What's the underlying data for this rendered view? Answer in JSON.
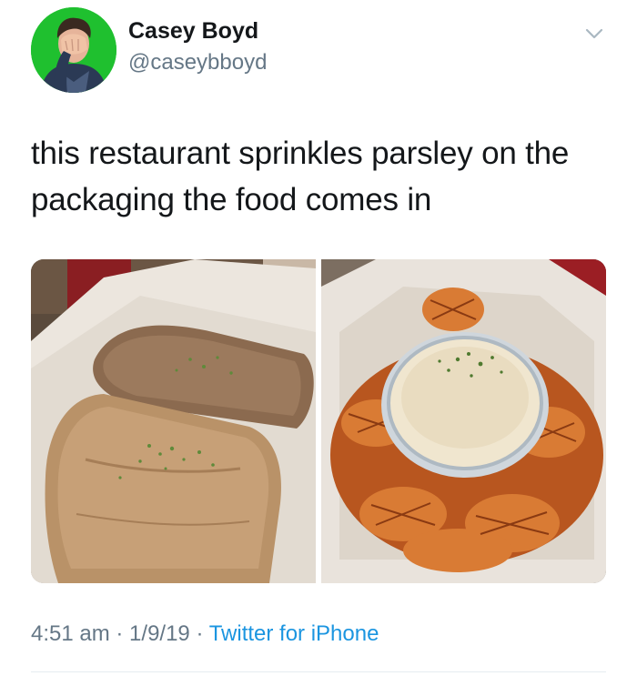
{
  "author": {
    "display_name": "Casey Boyd",
    "handle": "@caseybboyd",
    "avatar_icon": "facepalm-avatar",
    "avatar_color": "#1fc02f"
  },
  "tweet": {
    "text": "this restaurant sprinkles parsley on the packaging the food comes in",
    "media_count": 2
  },
  "meta": {
    "time": "4:51 am",
    "sep1": " · ",
    "date": "1/9/19",
    "sep2": " · ",
    "source": "Twitter for iPhone"
  },
  "menu_icon": "chevron-down-icon",
  "colors": {
    "text": "#14171a",
    "secondary": "#657786",
    "link": "#1b95e0",
    "divider": "#e6ecf0"
  }
}
